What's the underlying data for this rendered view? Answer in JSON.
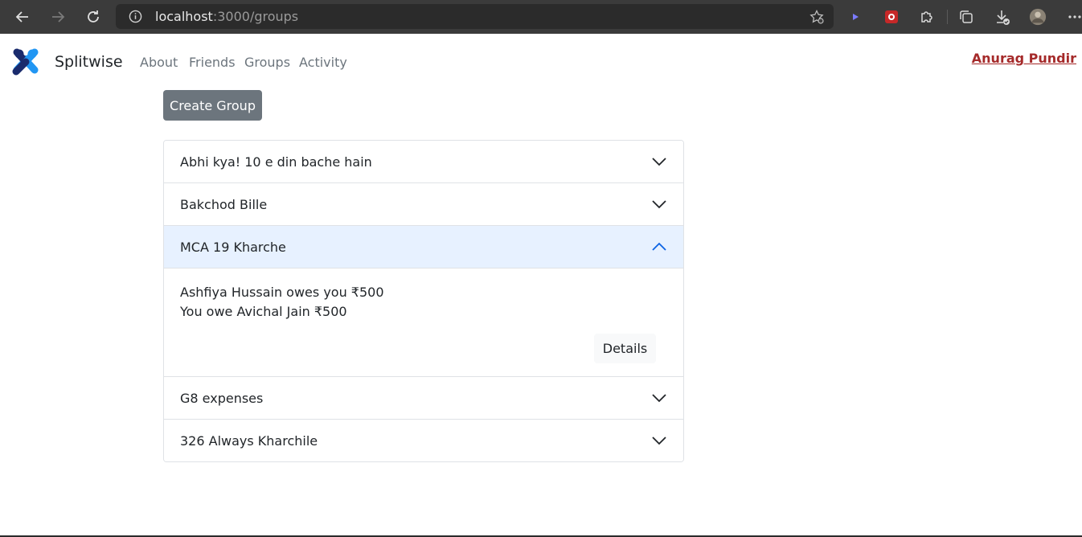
{
  "browser": {
    "url_host": "localhost",
    "url_path": ":3000/groups",
    "icons": [
      "back-arrow-icon",
      "forward-arrow-icon",
      "reload-icon",
      "info-icon",
      "favorites-star-icon",
      "play-extension-icon",
      "red-extension-icon",
      "puzzle-extension-icon",
      "collections-icon",
      "downloads-icon",
      "profile-avatar-icon",
      "more-menu-icon"
    ]
  },
  "navbar": {
    "brand": "Splitwise",
    "links": [
      "About",
      "Friends",
      "Groups",
      "Activity"
    ],
    "user": "Anurag Pundir"
  },
  "actions": {
    "create_group": "Create Group"
  },
  "groups": [
    {
      "name": "Abhi kya! 10 e din bache hain",
      "expanded": false
    },
    {
      "name": "Bakchod Bille",
      "expanded": false
    },
    {
      "name": "MCA 19 Kharche",
      "expanded": true,
      "balances": [
        "Ashfiya Hussain owes you ₹500",
        "You owe Avichal Jain ₹500"
      ],
      "details_label": "Details"
    },
    {
      "name": "G8 expenses",
      "expanded": false
    },
    {
      "name": "326 Always Kharchile",
      "expanded": false
    }
  ],
  "colors": {
    "chrome_bg": "#3b3b3b",
    "accent_blue": "#0c63e4",
    "open_header_bg": "#e7f1ff",
    "user_link": "#a52a2a",
    "secondary_btn": "#6c757d",
    "logo_dark": "#1a2b6d",
    "logo_light": "#2196f3"
  }
}
